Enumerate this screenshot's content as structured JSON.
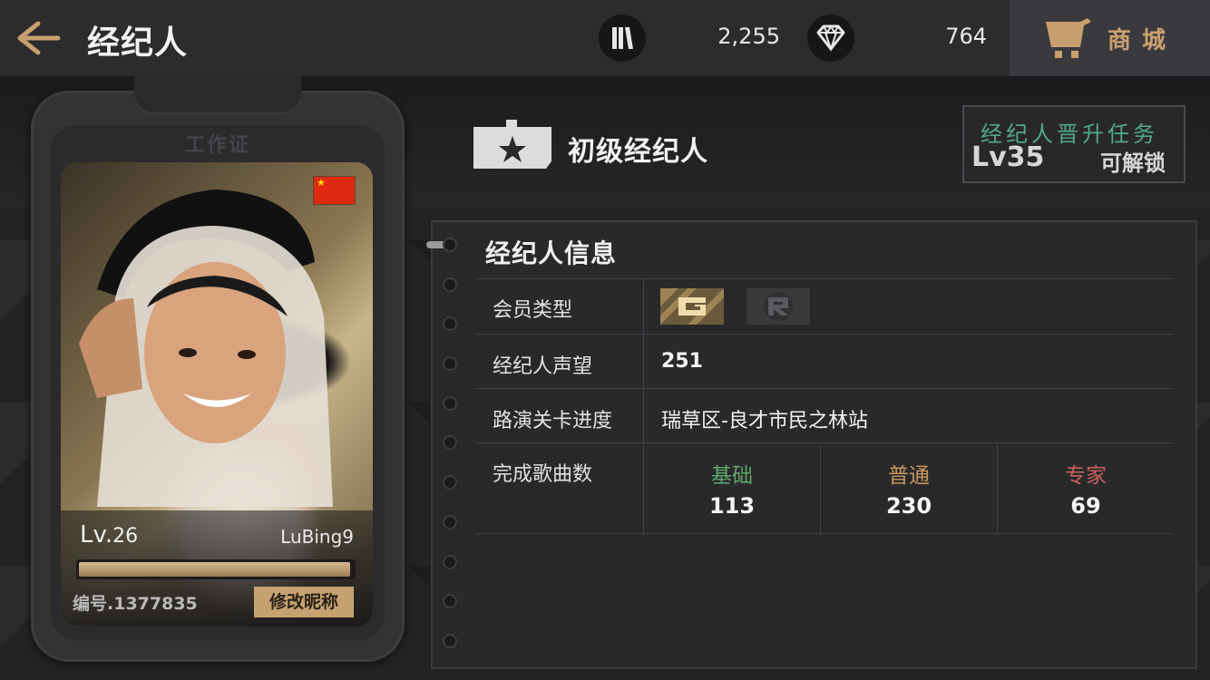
{
  "header": {
    "title": "经纪人",
    "currency_a_value": "2,255",
    "currency_b_value": "764",
    "shop_label": "商城",
    "icons": [
      "back-arrow-icon",
      "bars-currency-icon",
      "diamond-icon",
      "shop-cart-icon"
    ]
  },
  "badge": {
    "card_label": "工作证",
    "level_prefix": "Lv.",
    "level": "26",
    "name": "LuBing9",
    "xp_progress": 0.99,
    "id_text": "编号.1377835",
    "rename_label": "修改昵称",
    "flag": "China"
  },
  "rank": {
    "title": "初级经纪人",
    "promo_title": "经纪人晋升任务",
    "promo_level": "Lv35",
    "promo_unlock": "可解锁"
  },
  "info": {
    "title": "经纪人信息",
    "rows": {
      "membership_label": "会员类型",
      "reputation_label": "经纪人声望",
      "reputation_value": "251",
      "progress_label": "路演关卡进度",
      "progress_value": "瑞草区-良才市民之林站",
      "songs_label": "完成歌曲数"
    },
    "songs": [
      {
        "label": "基础",
        "value": "113",
        "color": "#5fa86a"
      },
      {
        "label": "普通",
        "value": "230",
        "color": "#c9975c"
      },
      {
        "label": "专家",
        "value": "69",
        "color": "#c9605a"
      }
    ]
  },
  "colors": {
    "accent": "#c8a070",
    "promo_green": "#52a888",
    "background": "#1f1f22"
  }
}
